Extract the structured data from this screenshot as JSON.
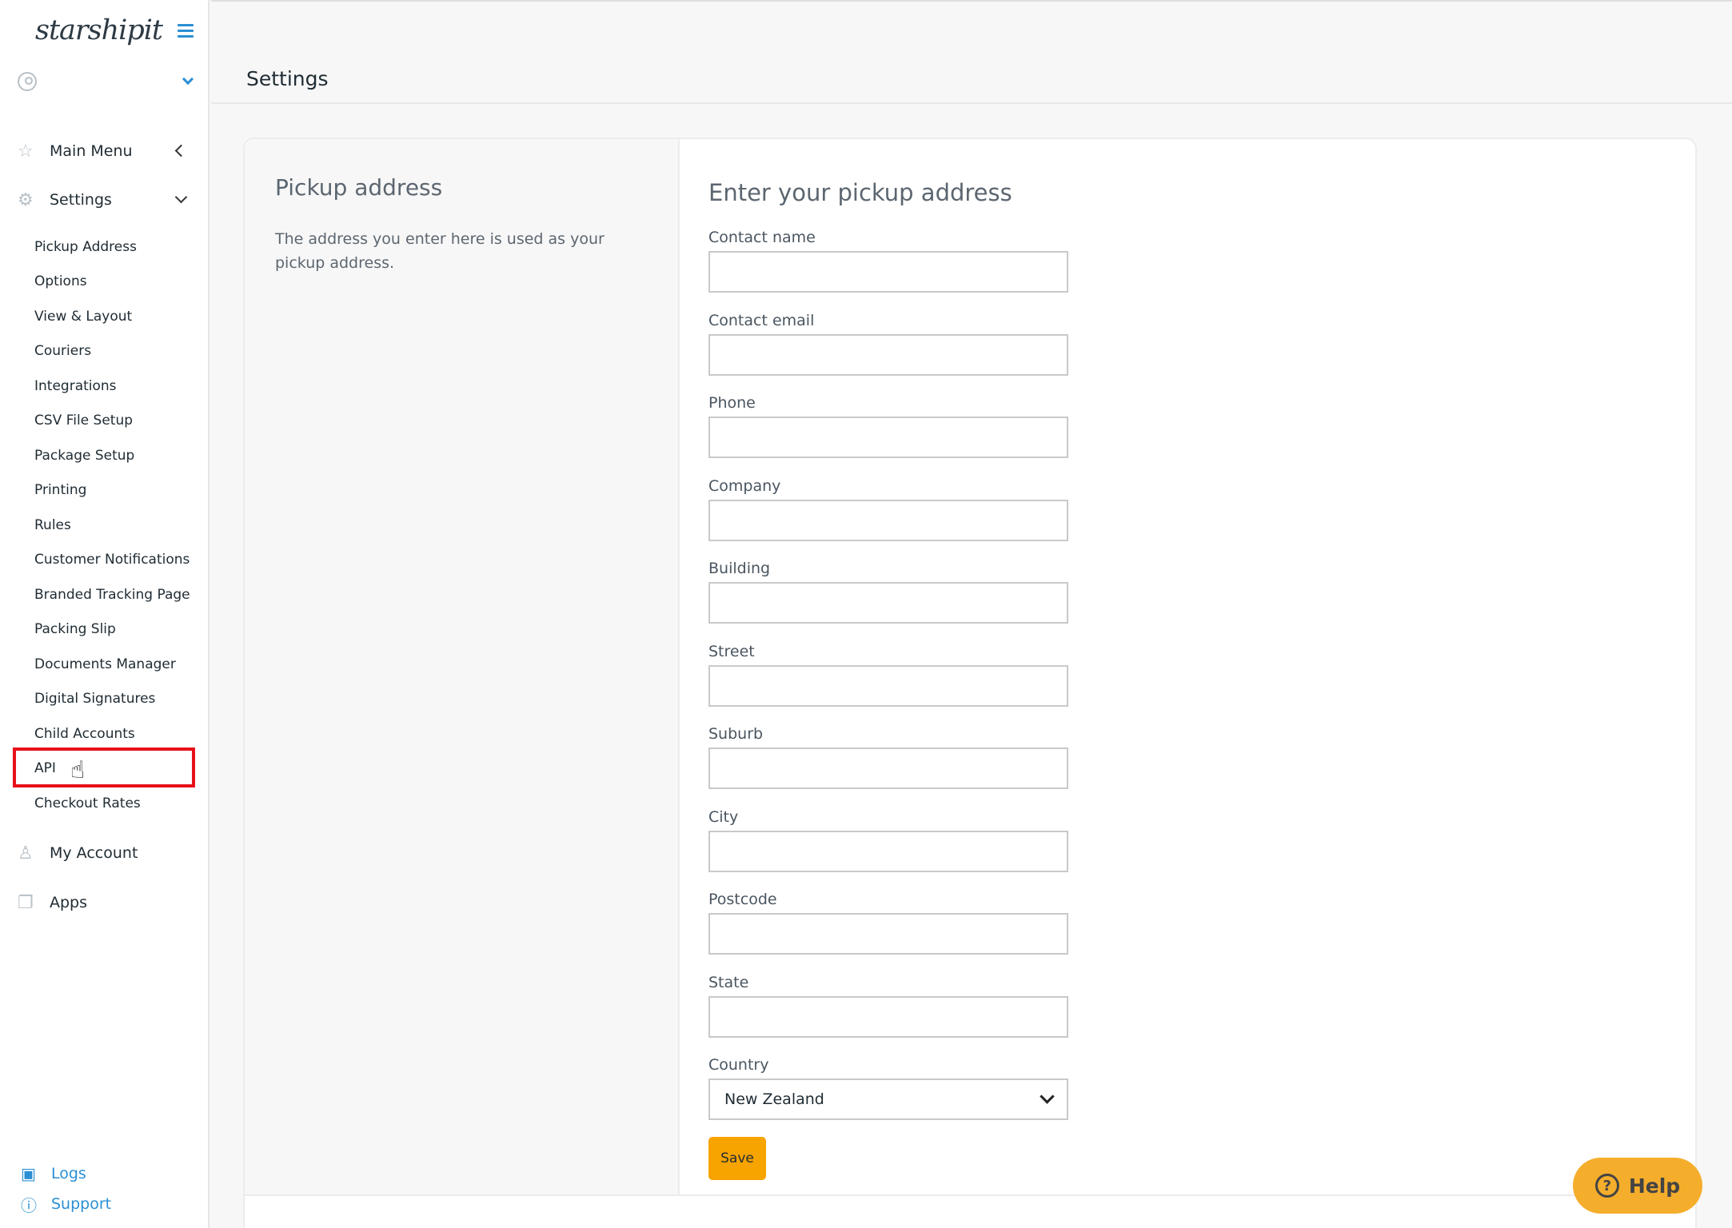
{
  "sidebar": {
    "brand": "starshipit",
    "main_menu": "Main Menu",
    "settings": "Settings",
    "settings_items": [
      "Pickup Address",
      "Options",
      "View & Layout",
      "Couriers",
      "Integrations",
      "CSV File Setup",
      "Package Setup",
      "Printing",
      "Rules",
      "Customer Notifications",
      "Branded Tracking Page",
      "Packing Slip",
      "Documents Manager",
      "Digital Signatures",
      "Child Accounts",
      "API",
      "Checkout Rates"
    ],
    "my_account": "My Account",
    "apps": "Apps",
    "logs": "Logs",
    "support": "Support"
  },
  "header": {
    "title": "Settings"
  },
  "section": {
    "title": "Pickup address",
    "description": "The address you enter here is used as your pickup address."
  },
  "form": {
    "title": "Enter your pickup address",
    "fields": [
      {
        "label": "Contact name",
        "value": ""
      },
      {
        "label": "Contact email",
        "value": ""
      },
      {
        "label": "Phone",
        "value": ""
      },
      {
        "label": "Company",
        "value": ""
      },
      {
        "label": "Building",
        "value": ""
      },
      {
        "label": "Street",
        "value": ""
      },
      {
        "label": "Suburb",
        "value": ""
      },
      {
        "label": "City",
        "value": ""
      },
      {
        "label": "Postcode",
        "value": ""
      },
      {
        "label": "State",
        "value": ""
      }
    ],
    "country_label": "Country",
    "country_value": "New Zealand",
    "save_label": "Save"
  },
  "help": {
    "label": "Help"
  },
  "colors": {
    "accent": "#2a8fd4",
    "save": "#f7a300",
    "help": "#f5ad2c",
    "highlight": "#e8101a"
  }
}
